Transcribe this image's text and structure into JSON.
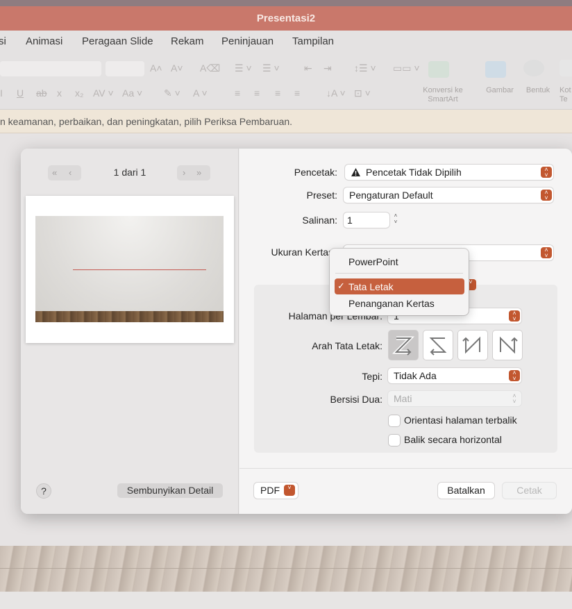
{
  "window": {
    "title": "Presentasi2"
  },
  "menu_tabs": [
    "si",
    "Animasi",
    "Peragaan Slide",
    "Rekam",
    "Peninjauan",
    "Tampilan"
  ],
  "ribbon": {
    "buttons": [
      {
        "label": "Konversi ke SmartArt",
        "icon": "smartart-icon"
      },
      {
        "label": "Gambar",
        "icon": "picture-icon"
      },
      {
        "label": "Bentuk",
        "icon": "shapes-icon"
      },
      {
        "label": "Kot Te",
        "icon": "textbox-icon"
      }
    ]
  },
  "banner": {
    "text": "n keamanan, perbaikan, dan peningkatan, pilih Periksa Pembaruan."
  },
  "print_dialog": {
    "preview": {
      "page_count": "1 dari 1"
    },
    "help_label": "?",
    "hide_details_label": "Sembunyikan Detail",
    "printer": {
      "label": "Pencetak:",
      "value": "Pencetak Tidak Dipilih",
      "icon": "warning-icon"
    },
    "preset": {
      "label": "Preset:",
      "value": "Pengaturan Default"
    },
    "copies": {
      "label": "Salinan:",
      "value": "1"
    },
    "paper_size": {
      "label": "Ukuran Kertas"
    },
    "section_menu": {
      "items": [
        {
          "label": "PowerPoint",
          "selected": false
        },
        {
          "label": "Tata Letak",
          "selected": true
        },
        {
          "label": "Penanganan Kertas",
          "selected": false
        }
      ],
      "check": "✓"
    },
    "layout": {
      "pages_per_sheet": {
        "label": "Halaman per Lembar:",
        "value": "1"
      },
      "direction": {
        "label": "Arah Tata Letak:",
        "options": [
          "Z",
          "reverse-Z",
          "N-reverse",
          "N"
        ],
        "selected_index": 0
      },
      "border": {
        "label": "Tepi:",
        "value": "Tidak Ada"
      },
      "two_sided": {
        "label": "Bersisi Dua:",
        "value": "Mati"
      },
      "reverse_orientation": {
        "label": "Orientasi halaman terbalik",
        "checked": false
      },
      "flip_horizontal": {
        "label": "Balik secara horizontal",
        "checked": false
      }
    },
    "pdf_label": "PDF",
    "cancel_label": "Batalkan",
    "print_label": "Cetak"
  },
  "colors": {
    "accent": "#c2572f",
    "titlebar": "#c9786b",
    "menu_highlight": "#c6603e"
  }
}
